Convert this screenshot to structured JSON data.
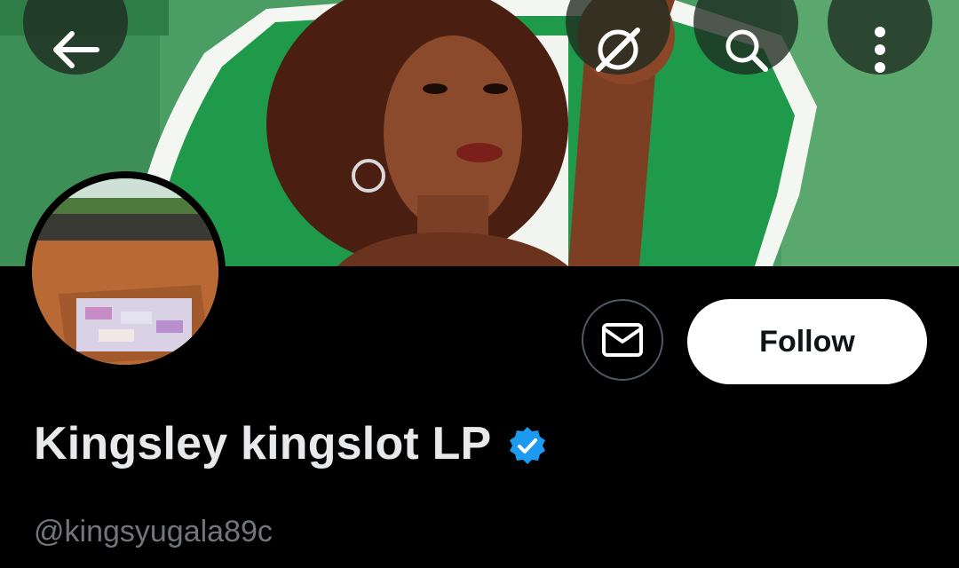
{
  "profile": {
    "display_name": "Kingsley kingslot LP",
    "handle": "@kingsyugala89c",
    "verified": true
  },
  "actions": {
    "follow_label": "Follow"
  },
  "icons": {
    "back": "arrow-left-icon",
    "grok": "grok-icon",
    "search": "search-icon",
    "more": "more-vertical-icon",
    "message": "envelope-icon",
    "verified": "verified-badge-icon"
  },
  "colors": {
    "background": "#000000",
    "name_text": "#e7e9ea",
    "handle_text": "#71767b",
    "follow_bg": "#ffffff",
    "verified_blue": "#1d9bf0",
    "banner_green": "#3f9a5c"
  }
}
